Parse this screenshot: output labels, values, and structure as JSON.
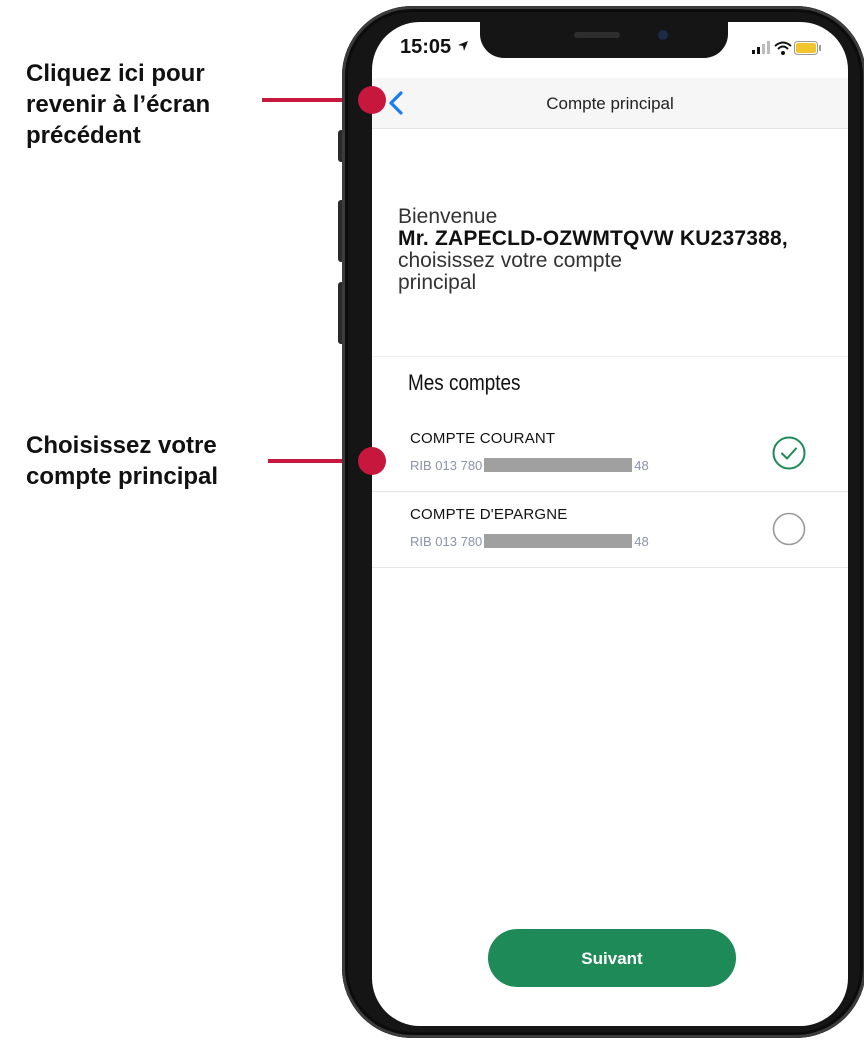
{
  "callouts": {
    "back": [
      "Cliquez ici pour",
      "revenir à l’écran",
      "précédent"
    ],
    "account": [
      "Choisissez votre",
      "compte principal"
    ]
  },
  "status_bar": {
    "time": "15:05"
  },
  "nav": {
    "title": "Compte principal",
    "back_icon": "chevron-left-icon"
  },
  "welcome": {
    "greeting": "Bienvenue",
    "name": "Mr. ZAPECLD-OZWMTQVW KU237388,",
    "instruction": "choisissez votre compte principal"
  },
  "accounts_section": {
    "title": "Mes comptes",
    "items": [
      {
        "name": "COMPTE COURANT",
        "rib_prefix": "RIB 013 780",
        "rib_suffix": "48",
        "selected": true
      },
      {
        "name": "COMPTE D'EPARGNE",
        "rib_prefix": "RIB 013 780",
        "rib_suffix": "48",
        "selected": false
      }
    ]
  },
  "next_button": {
    "label": "Suivant"
  },
  "colors": {
    "accent": "#1e8a57",
    "callout": "#c8173c",
    "ios_blue": "#1a7cf5"
  }
}
